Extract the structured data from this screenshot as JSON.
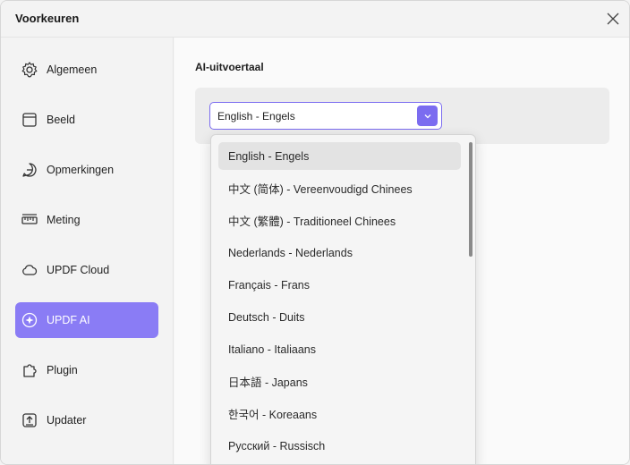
{
  "window": {
    "title": "Voorkeuren"
  },
  "sidebar": {
    "items": [
      {
        "label": "Algemeen",
        "icon": "gear-icon"
      },
      {
        "label": "Beeld",
        "icon": "layout-icon"
      },
      {
        "label": "Opmerkingen",
        "icon": "comment-icon"
      },
      {
        "label": "Meting",
        "icon": "ruler-icon"
      },
      {
        "label": "UPDF Cloud",
        "icon": "cloud-icon"
      },
      {
        "label": "UPDF AI",
        "icon": "ai-icon",
        "active": true
      },
      {
        "label": "Plugin",
        "icon": "puzzle-icon"
      },
      {
        "label": "Updater",
        "icon": "update-icon"
      }
    ]
  },
  "main": {
    "section_title": "AI-uitvoertaal",
    "select": {
      "value": "English - Engels"
    },
    "options": [
      "English - Engels",
      "中文 (简体) - Vereenvoudigd Chinees",
      "中文 (繁體) - Traditioneel Chinees",
      "Nederlands - Nederlands",
      "Français - Frans",
      "Deutsch - Duits",
      "Italiano - Italiaans",
      "日本語 - Japans",
      "한국어 - Koreaans",
      "Русский - Russisch"
    ],
    "selected_index": 0
  },
  "colors": {
    "accent": "#8a7cf5",
    "select_border": "#7b6cf0"
  }
}
